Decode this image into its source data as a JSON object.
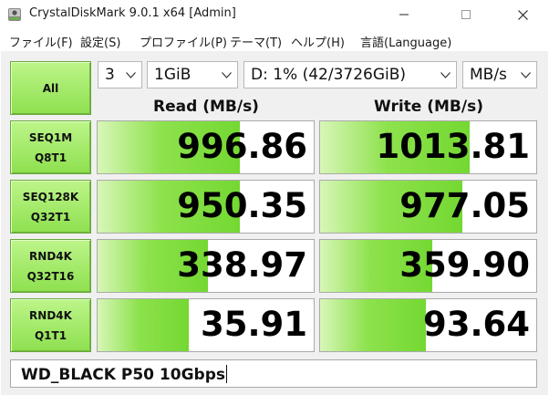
{
  "window": {
    "title": "CrystalDiskMark 9.0.1 x64 [Admin]"
  },
  "menu": [
    "ファイル(F)",
    "設定(S)",
    "プロファイル(P)",
    "テーマ(T)",
    "ヘルプ(H)",
    "言語(Language)"
  ],
  "controls": {
    "all_label": "All",
    "count": "3",
    "size": "1GiB",
    "drive": "D: 1% (42/3726GiB)",
    "unit": "MB/s"
  },
  "headers": {
    "read": "Read (MB/s)",
    "write": "Write (MB/s)"
  },
  "tests": [
    {
      "line1": "SEQ1M",
      "line2": "Q8T1",
      "read": "996.86",
      "write": "1013.81",
      "read_fill": 0.66,
      "write_fill": 0.69
    },
    {
      "line1": "SEQ128K",
      "line2": "Q32T1",
      "read": "950.35",
      "write": "977.05",
      "read_fill": 0.66,
      "write_fill": 0.66
    },
    {
      "line1": "RND4K",
      "line2": "Q32T16",
      "read": "338.97",
      "write": "359.90",
      "read_fill": 0.51,
      "write_fill": 0.52
    },
    {
      "line1": "RND4K",
      "line2": "Q1T1",
      "read": "35.91",
      "write": "93.64",
      "read_fill": 0.42,
      "write_fill": 0.49
    }
  ],
  "comment": "WD_BLACK P50 10Gbps",
  "colors": {
    "button_green": "#9be85e",
    "bar_green": "#74d832"
  }
}
